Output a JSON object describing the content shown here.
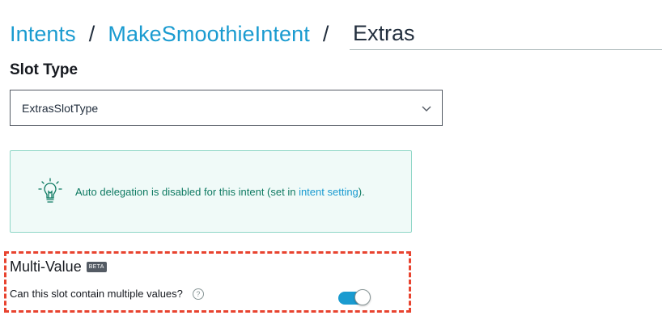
{
  "breadcrumb": {
    "items": [
      "Intents",
      "MakeSmoothieIntent"
    ],
    "separator": "/",
    "current": "Extras"
  },
  "slot_type": {
    "title": "Slot Type",
    "selected": "ExtrasSlotType"
  },
  "info": {
    "icon": "lightbulb-icon",
    "text_before": "Auto delegation is disabled for this intent (set in ",
    "link": "intent setting",
    "text_after": ")."
  },
  "multi_value": {
    "title": "Multi-Value",
    "badge": "BETA",
    "question": "Can this slot contain multiple values?",
    "help_glyph": "?",
    "toggle_on": true
  },
  "colors": {
    "link": "#1a9bd0",
    "info_text": "#0e7a62",
    "info_border": "#8ed6c6",
    "highlight": "#e8432f",
    "toggle_on": "#1a9bd0"
  }
}
